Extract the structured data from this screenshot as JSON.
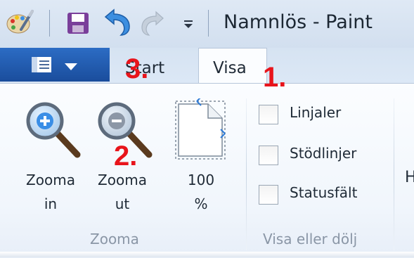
{
  "window": {
    "title": "Namnlös - Paint"
  },
  "tabs": {
    "start": "Start",
    "visa": "Visa"
  },
  "zoom_group": {
    "zoom_in": {
      "line1": "Zooma",
      "line2": "in"
    },
    "zoom_out": {
      "line1": "Zooma",
      "line2": "ut"
    },
    "zoom_100": {
      "line1": "100",
      "line2": "%"
    },
    "label": "Zooma"
  },
  "show_hide_group": {
    "label": "Visa eller dölj",
    "items": [
      {
        "label": "Linjaler",
        "checked": false
      },
      {
        "label": "Stödlinjer",
        "checked": false
      },
      {
        "label": "Statusfält",
        "checked": false
      }
    ]
  },
  "cut_off_text": "H",
  "annotations": {
    "a1": "1.",
    "a2": "2.",
    "a3": "3."
  },
  "colors": {
    "file_menu": "#1f5bb0",
    "annotation": "#e8141b",
    "ribbon_bg": "#f6f9fd"
  },
  "icons": {
    "app": "paint-palette-icon",
    "save": "save-icon",
    "undo": "undo-icon",
    "redo": "redo-icon",
    "qat_dropdown": "dropdown-arrow-icon",
    "file_menu": "file-menu-icon",
    "zoom_in": "magnifier-plus-icon",
    "zoom_out": "magnifier-minus-icon",
    "zoom_100": "page-actual-size-icon"
  }
}
